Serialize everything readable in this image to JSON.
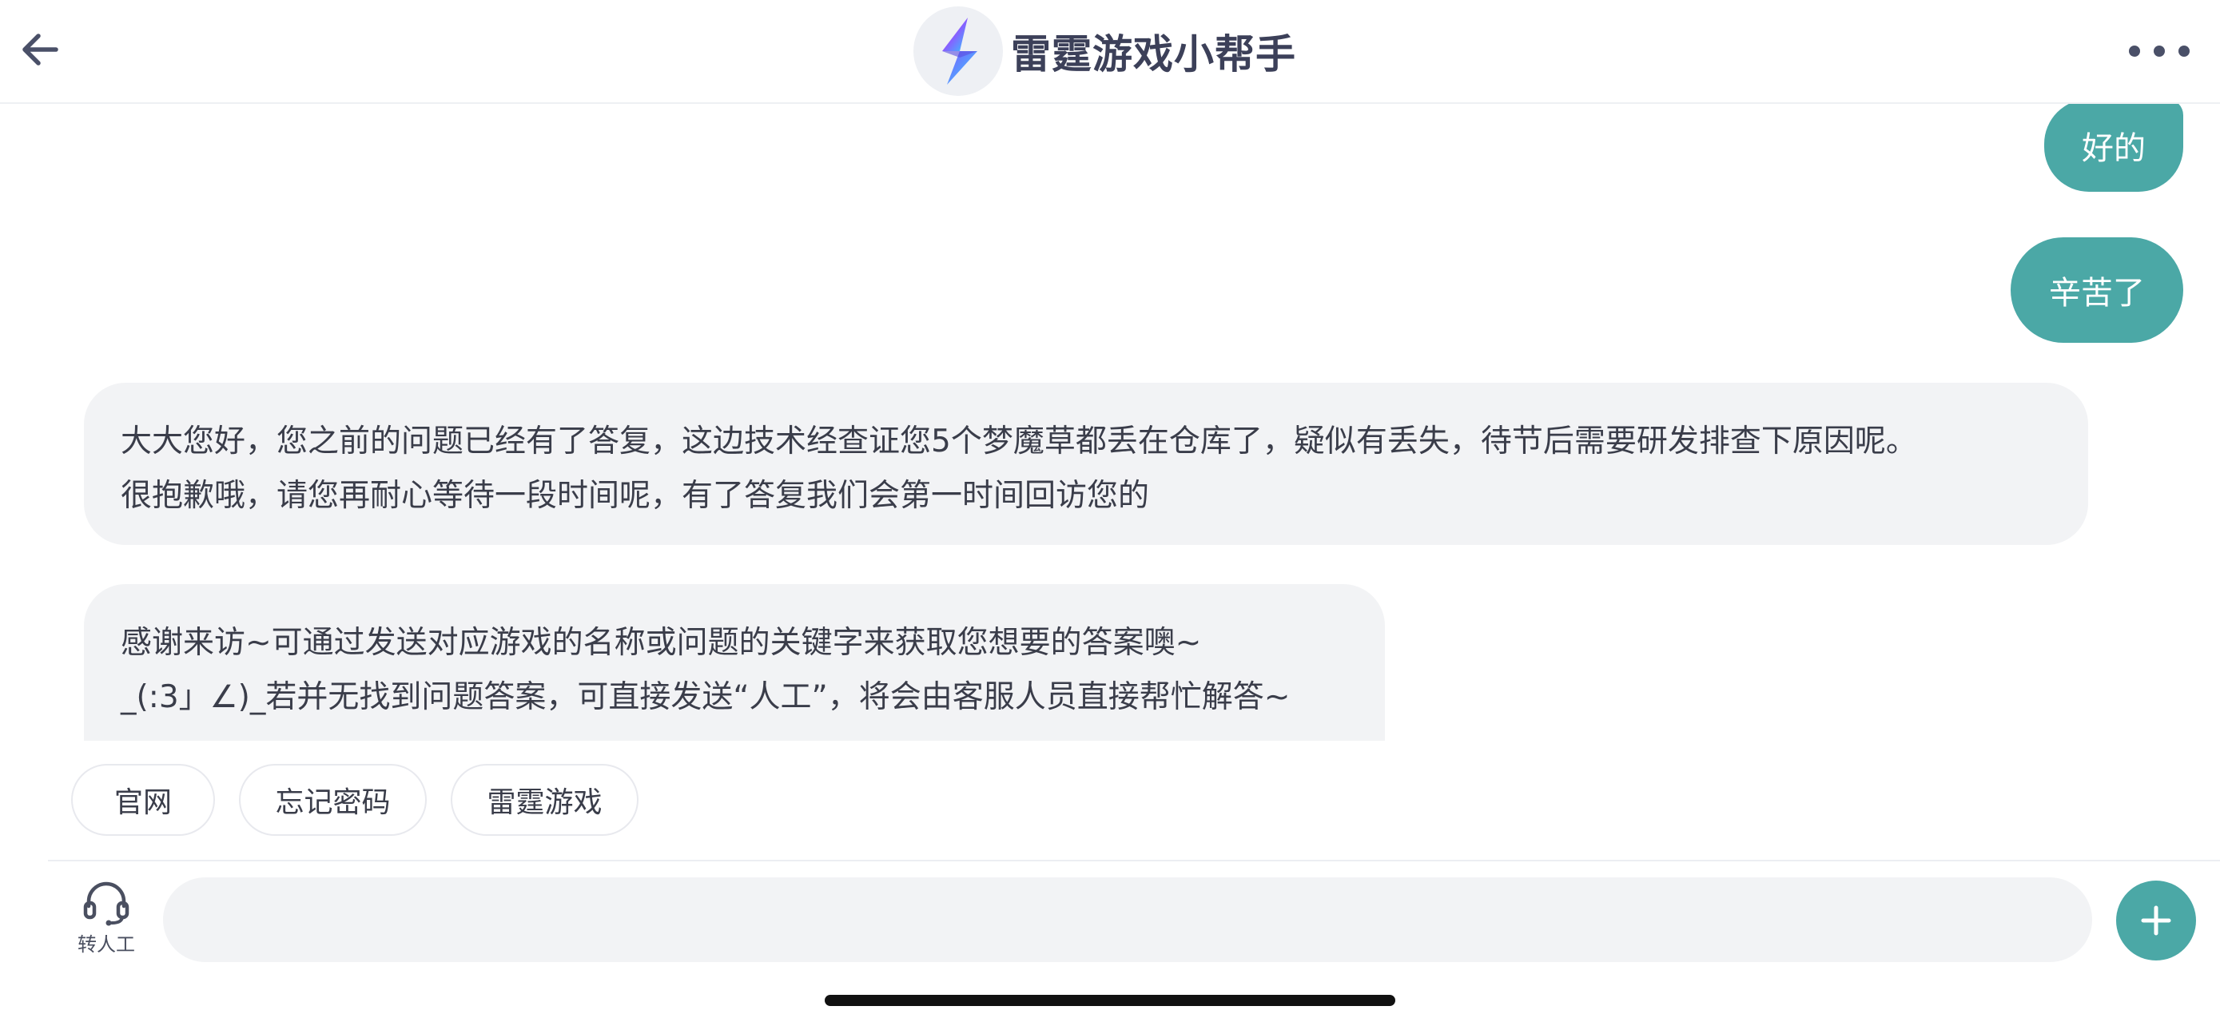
{
  "header": {
    "title": "雷霆游戏小帮手",
    "back_icon": "arrow-left-icon",
    "logo_icon": "lightning-logo-icon",
    "more_icon": "more-dots-icon"
  },
  "messages": {
    "user_1": "好的",
    "user_2": "辛苦了",
    "bot_1": {
      "line_1": "大大您好，您之前的问题已经有了答复，这边技术经查证您5个梦魔草都丢在仓库了，疑似有丢失，待节后需要研发排查下原因呢。",
      "line_2": "很抱歉哦，请您再耐心等待一段时间呢，有了答复我们会第一时间回访您的"
    },
    "bot_2": {
      "line_1": "感谢来访~可通过发送对应游戏的名称或问题的关键字来获取您想要的答案噢~",
      "line_2": "_(:3」∠)_若并无找到问题答案，可直接发送“人工”，将会由客服人员直接帮忙解答~"
    }
  },
  "quick_replies": [
    "官网",
    "忘记密码",
    "雷霆游戏"
  ],
  "input_bar": {
    "agent_label": "转人工",
    "agent_icon": "headset-icon",
    "input_value": "",
    "plus_icon": "plus-icon"
  },
  "colors": {
    "accent": "#4ba8a6",
    "bot_bubble": "#f2f3f5",
    "title_text": "#3c4059",
    "link": "#5b8ff0"
  }
}
